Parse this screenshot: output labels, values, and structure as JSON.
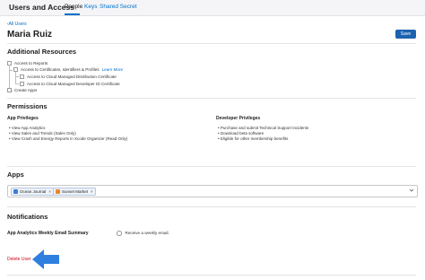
{
  "header": {
    "title": "Users and Access",
    "tabs": [
      {
        "label": "People",
        "active": true
      },
      {
        "label": "Keys",
        "active": false
      },
      {
        "label": "Shared Secret",
        "active": false
      }
    ]
  },
  "back_link": "All Users",
  "user": {
    "name": "Maria Ruiz"
  },
  "save_label": "Save",
  "additional_resources": {
    "title": "Additional Resources",
    "items": [
      {
        "label": "Access to Reports"
      },
      {
        "label": "Access to Certificates, Identifiers & Profiles",
        "link": "Learn More"
      },
      {
        "label": "Access to Cloud Managed Distribution Certificate"
      },
      {
        "label": "Access to Cloud Managed Developer ID Certificate"
      },
      {
        "label": "Create Apps"
      }
    ]
  },
  "permissions": {
    "title": "Permissions",
    "app_privileges": {
      "title": "App Privileges",
      "items": [
        "View App Analytics",
        "View Sales and Trends (Sales Only)",
        "View Crash and Energy Reports in Xcode Organizer (Read Only)"
      ]
    },
    "developer_privileges": {
      "title": "Developer Privileges",
      "items": [
        "Purchase and submit Technical Support Incidents",
        "Download beta software",
        "Eligible for other membership benefits"
      ]
    }
  },
  "apps": {
    "title": "Apps",
    "selected": [
      {
        "name": "Ocean Journal",
        "icon_color": "#3d7bd9"
      },
      {
        "name": "Sunset Market",
        "icon_color": "#e8892b"
      }
    ]
  },
  "notifications": {
    "title": "Notifications",
    "label": "App Analytics Weekly Email Summary",
    "option": "Receive a weekly email."
  },
  "delete_label": "Delete User",
  "colors": {
    "accent": "#0070c9",
    "save_button": "#1e62b0",
    "danger": "#d70015",
    "arrow": "#2f7fe0"
  }
}
